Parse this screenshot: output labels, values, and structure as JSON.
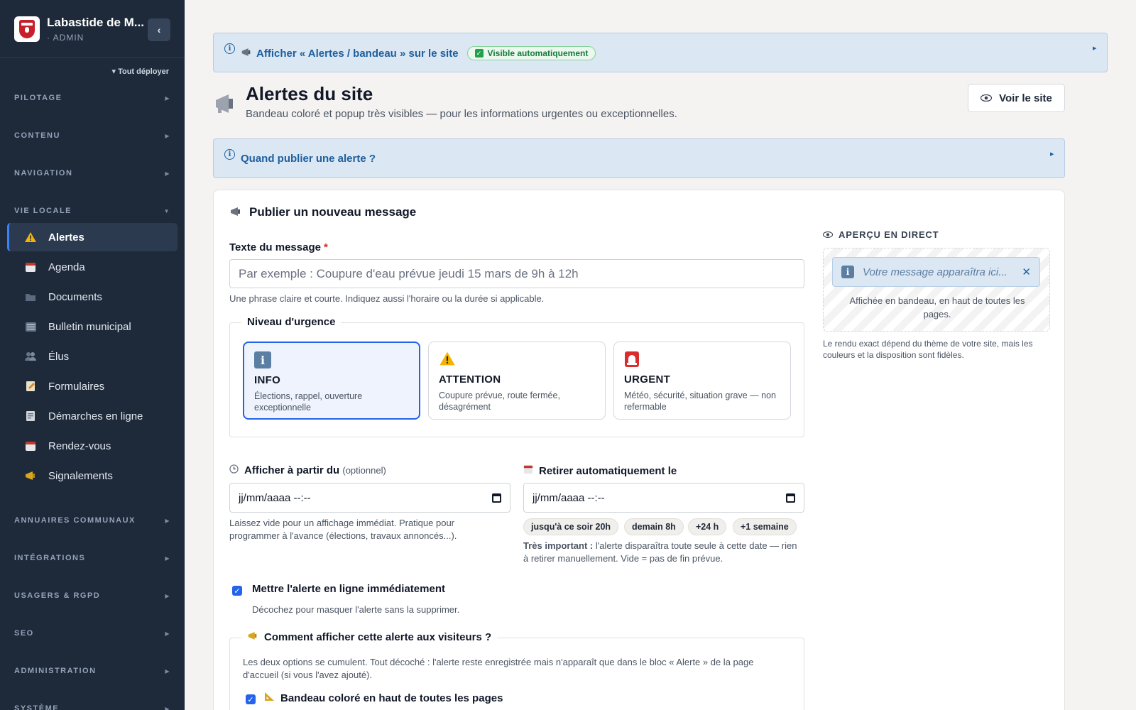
{
  "sidebar": {
    "brand_title": "Labastide de M...",
    "brand_sub": "· ADMIN",
    "collapse_icon": "‹",
    "deploy_all": "Tout déployer",
    "sections": {
      "pilotage": "PILOTAGE",
      "contenu": "CONTENU",
      "navigation": "NAVIGATION",
      "vie_locale": "VIE LOCALE",
      "annuaires": "ANNUAIRES COMMUNAUX",
      "integrations": "INTÉGRATIONS",
      "usagers": "USAGERS & RGPD",
      "seo": "SEO",
      "administration": "ADMINISTRATION",
      "systeme": "SYSTÈME"
    },
    "items": [
      {
        "label": "Alertes",
        "icon": "warning-icon"
      },
      {
        "label": "Agenda",
        "icon": "calendar-icon"
      },
      {
        "label": "Documents",
        "icon": "folder-icon"
      },
      {
        "label": "Bulletin municipal",
        "icon": "newspaper-icon"
      },
      {
        "label": "Élus",
        "icon": "people-icon"
      },
      {
        "label": "Formulaires",
        "icon": "memo-icon"
      },
      {
        "label": "Démarches en ligne",
        "icon": "receipt-icon"
      },
      {
        "label": "Rendez-vous",
        "icon": "calendar-icon"
      },
      {
        "label": "Signalements",
        "icon": "megaphone-icon"
      }
    ]
  },
  "banner": {
    "text": "Afficher « Alertes / bandeau » sur le site",
    "badge": "Visible automatiquement"
  },
  "header": {
    "title": "Alertes du site",
    "subtitle": "Bandeau coloré et popup très visibles — pour les informations urgentes ou exceptionnelles.",
    "view_site": "Voir le site"
  },
  "help": {
    "text": "Quand publier une alerte ?"
  },
  "form": {
    "title": "Publier un nouveau message",
    "message_label": "Texte du message",
    "required_mark": "*",
    "message_placeholder": "Par exemple : Coupure d'eau prévue jeudi 15 mars de 9h à 12h",
    "message_hint": "Une phrase claire et courte. Indiquez aussi l'horaire ou la durée si applicable.",
    "urgency_legend": "Niveau d'urgence",
    "urgency": [
      {
        "title": "INFO",
        "desc": "Élections, rappel, ouverture exceptionnelle",
        "icon": "info-icon",
        "color": "#5b7ea3"
      },
      {
        "title": "ATTENTION",
        "desc": "Coupure prévue, route fermée, désagrément",
        "icon": "warning-icon",
        "color": "#f5b301"
      },
      {
        "title": "URGENT",
        "desc": "Météo, sécurité, situation grave — non refermable",
        "icon": "siren-icon",
        "color": "#d92d2d"
      }
    ],
    "start_label": "Afficher à partir du",
    "start_optional": "(optionnel)",
    "start_value": "jj/mm/aaaa --:--",
    "start_hint": "Laissez vide pour un affichage immédiat. Pratique pour programmer à l'avance (élections, travaux annoncés...).",
    "end_label": "Retirer automatiquement le",
    "end_value": "jj/mm/aaaa --:--",
    "chips": [
      "jusqu'à ce soir 20h",
      "demain 8h",
      "+24 h",
      "+1 semaine"
    ],
    "end_hint_strong": "Très important :",
    "end_hint": " l'alerte disparaîtra toute seule à cette date — rien à retirer manuellement. Vide = pas de fin prévue.",
    "online_label": "Mettre l'alerte en ligne immédiatement",
    "online_hint": "Décochez pour masquer l'alerte sans la supprimer.",
    "display_legend": "Comment afficher cette alerte aux visiteurs ?",
    "display_hint": "Les deux options se cumulent. Tout décoché : l'alerte reste enregistrée mais n'apparaît que dans le bloc « Alerte » de la page d'accueil (si vous l'avez ajouté).",
    "banner_option": "Bandeau coloré en haut de toutes les pages"
  },
  "preview": {
    "label": "APERÇU EN DIRECT",
    "alert_text": "Votre message apparaîtra ici...",
    "caption": "Affichée en bandeau, en haut de toutes les pages.",
    "note": "Le rendu exact dépend du thème de votre site, mais les couleurs et la disposition sont fidèles."
  },
  "colors": {
    "sidebar_bg": "#1e2a3a",
    "accent": "#2563eb",
    "info_bg": "#dbe7f3",
    "info_text": "#1e5f9e"
  }
}
